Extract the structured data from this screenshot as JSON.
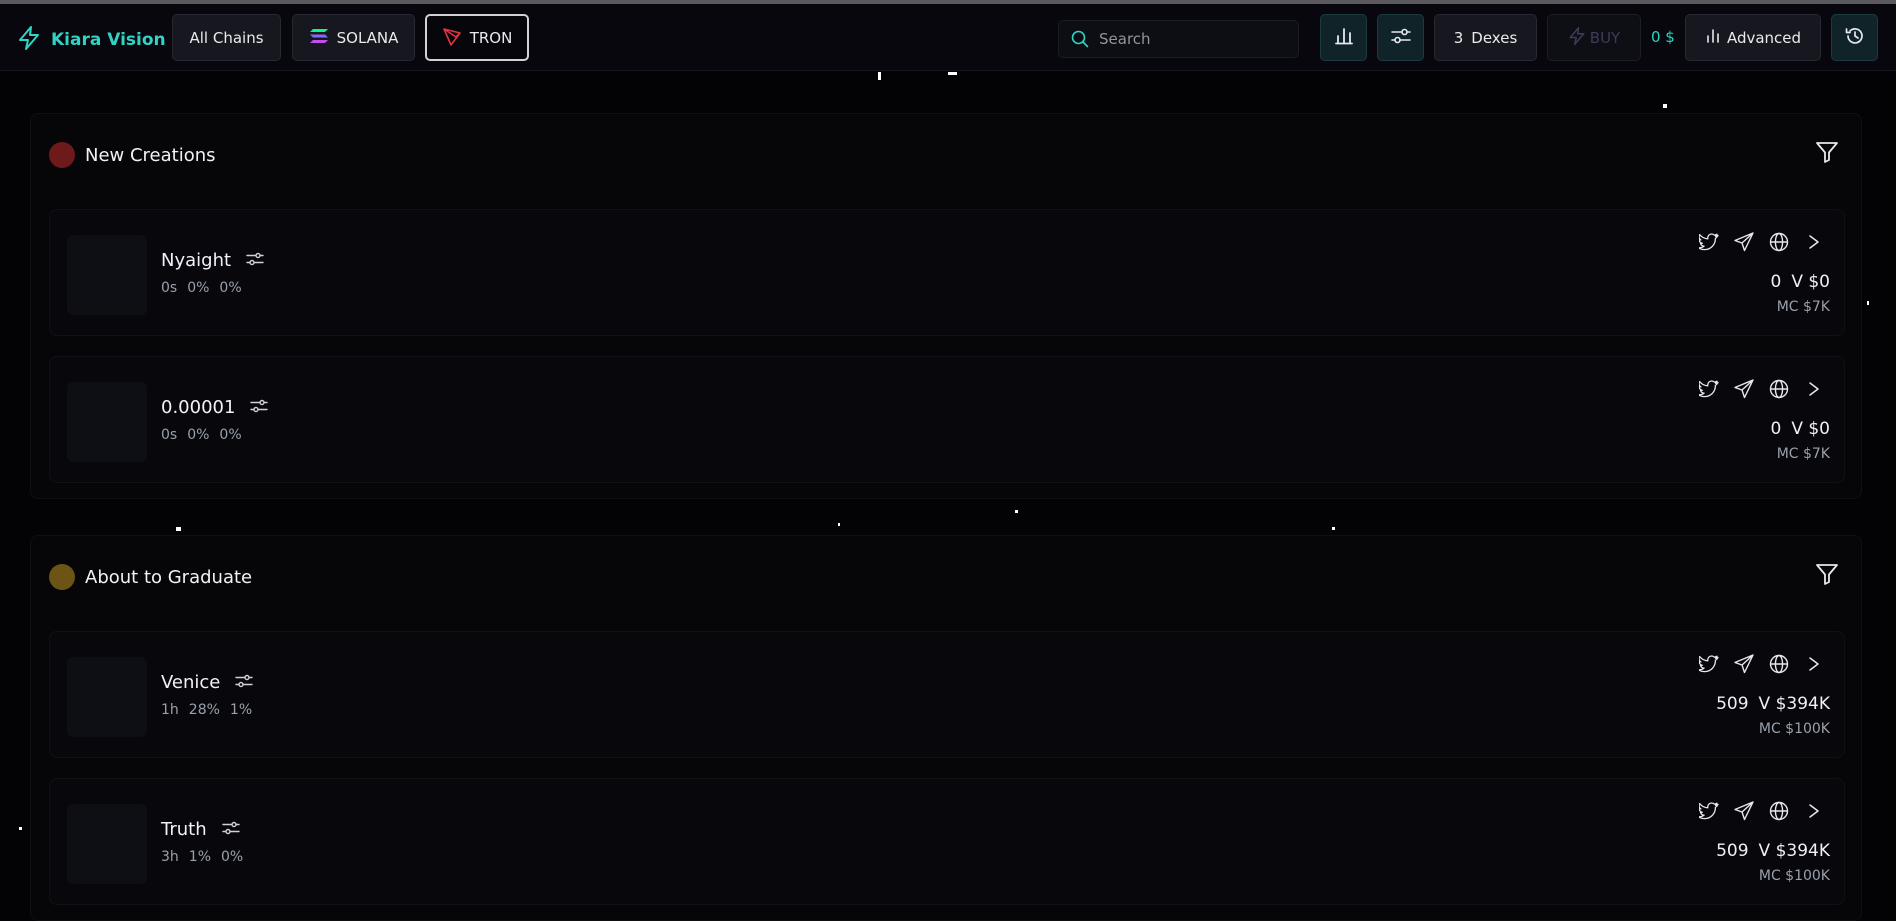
{
  "brand": {
    "name": "Kiara Vision",
    "icon": "lightning-bolt-icon"
  },
  "nav": {
    "all_chains": "All Chains",
    "solana": "SOLANA",
    "tron": "TRON",
    "search_placeholder": "Search",
    "dex_count": "3",
    "dex_label": "Dexes",
    "buy_label": "BUY",
    "balance": "0 $",
    "advanced_label": "Advanced"
  },
  "colors": {
    "accent": "#2fd4c4",
    "new_creations_dot": "#6e1a1a",
    "about_to_graduate_dot": "#6b5415",
    "tron_red": "#e0343c"
  },
  "sections": [
    {
      "title": "New Creations",
      "tokens": [
        {
          "name": "Nyaight",
          "stats": [
            "0s",
            "0%",
            "0%"
          ],
          "count": "0",
          "volume": "V $0",
          "mc": "MC $7K"
        },
        {
          "name": "0.00001",
          "stats": [
            "0s",
            "0%",
            "0%"
          ],
          "count": "0",
          "volume": "V $0",
          "mc": "MC $7K"
        }
      ]
    },
    {
      "title": "About to Graduate",
      "tokens": [
        {
          "name": "Venice",
          "stats": [
            "1h",
            "28%",
            "1%"
          ],
          "count": "509",
          "volume": "V $394K",
          "mc": "MC $100K"
        },
        {
          "name": "Truth",
          "stats": [
            "3h",
            "1%",
            "0%"
          ],
          "count": "509",
          "volume": "V $394K",
          "mc": "MC $100K"
        }
      ]
    }
  ],
  "link_icons": [
    "twitter-icon",
    "telegram-icon",
    "globe-icon",
    "arrow-icon"
  ]
}
